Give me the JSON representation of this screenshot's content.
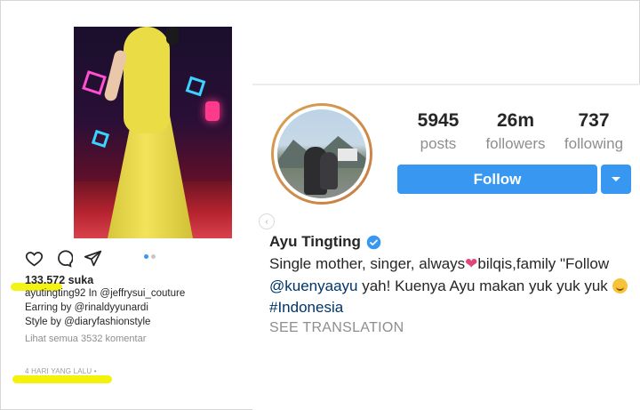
{
  "post": {
    "likes": "133.572 suka",
    "caption_lines": [
      "ayutingting92 In @jeffrysui_couture",
      "Earring by @rinaldyyunardi",
      "Style by @diaryfashionstyle"
    ],
    "view_comments": "Lihat semua 3532 komentar",
    "time_ago": "4 HARI YANG LALU • "
  },
  "profile": {
    "stats": [
      {
        "num": "5945",
        "label": "posts"
      },
      {
        "num": "26m",
        "label": "followers"
      },
      {
        "num": "737",
        "label": "following"
      }
    ],
    "follow_label": "Follow",
    "display_name": "Ayu Tingting",
    "bio": {
      "line1_start": "Single mother, singer, always",
      "line1_end": "bilqis,family \"Follow",
      "mention": "@kuenyaayu",
      "line2_rest": " yah! Kuenya Ayu makan yuk yuk yuk ",
      "hashtag": "#Indonesia"
    },
    "see_translation": "SEE TRANSLATION"
  },
  "colors": {
    "follow_blue": "#3897f0",
    "highlight_yellow": "#f4f10a",
    "avatar_ring": "#d8a253"
  }
}
